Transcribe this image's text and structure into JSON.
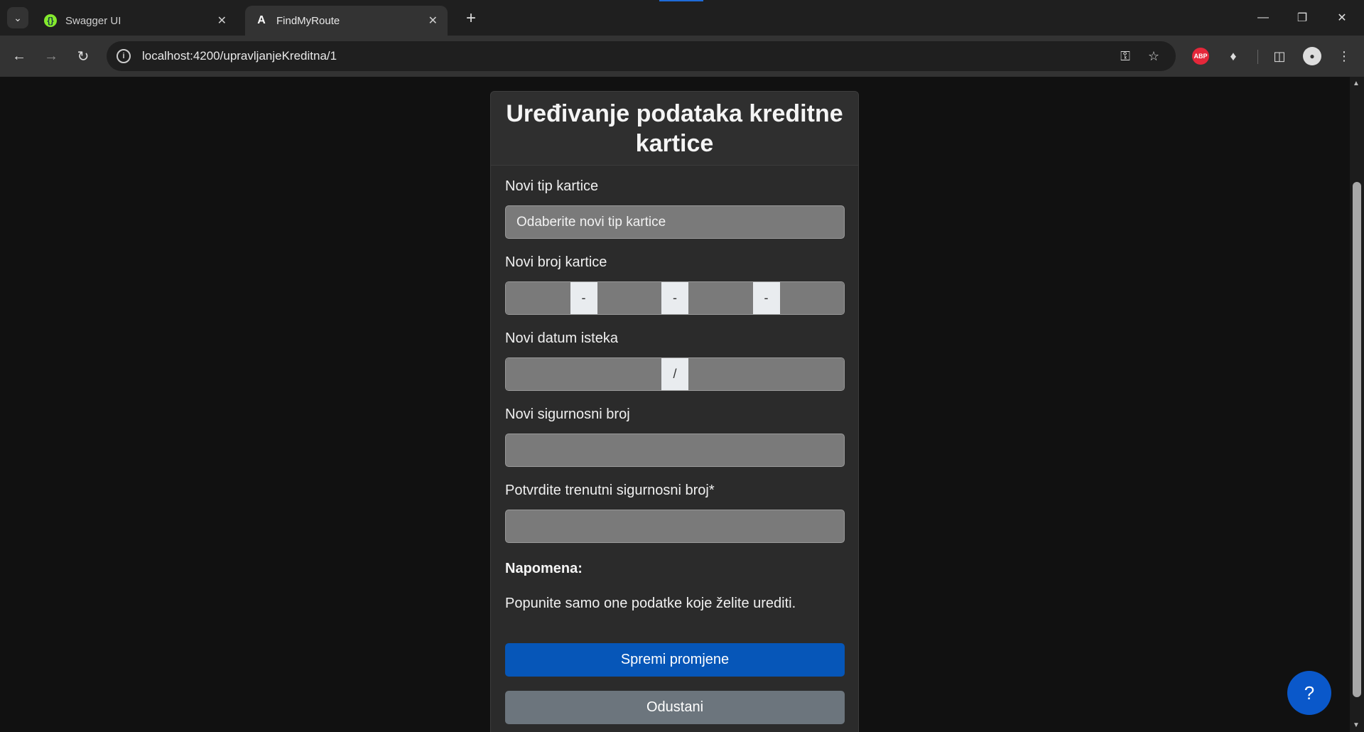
{
  "browser": {
    "tabs": [
      {
        "title": "Swagger UI",
        "favicon": "swagger-icon",
        "color": "#85ea2d"
      },
      {
        "title": "FindMyRoute",
        "favicon": "angular-icon",
        "color": "#ffffff"
      }
    ],
    "url": "localhost:4200/upravljanjeKreditna/1"
  },
  "form": {
    "title": "Uređivanje podataka kreditne kartice",
    "card_type_label": "Novi tip kartice",
    "card_type_placeholder": "Odaberite novi tip kartice",
    "card_number_label": "Novi broj kartice",
    "card_number_separator": "-",
    "expiry_label": "Novi datum isteka",
    "expiry_separator": "/",
    "new_cvv_label": "Novi sigurnosni broj",
    "confirm_cvv_label": "Potvrdite trenutni sigurnosni broj*",
    "note_title": "Napomena:",
    "note_text": "Popunite samo one podatke koje želite urediti.",
    "save_label": "Spremi promjene",
    "cancel_label": "Odustani"
  },
  "help_button": {
    "label": "?"
  },
  "colors": {
    "primary": "#0656b8",
    "secondary": "#6c757d",
    "background": "#111111",
    "card": "#2b2b2b"
  }
}
